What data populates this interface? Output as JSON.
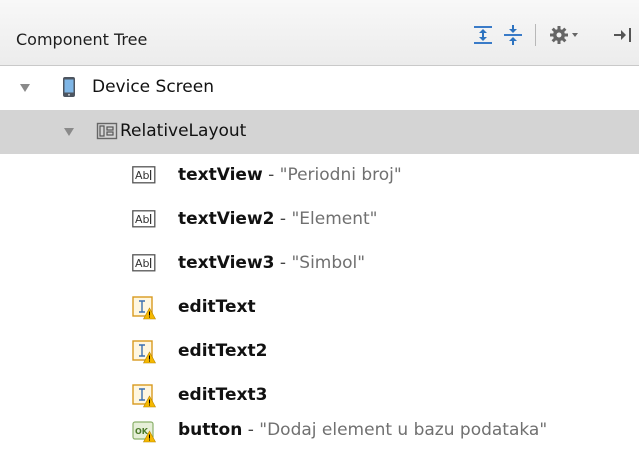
{
  "panel": {
    "title": "Component Tree"
  },
  "toolbar": {
    "icons": [
      "expand-all-icon",
      "collapse-all-icon",
      "gear-icon",
      "hide-panel-icon"
    ]
  },
  "tree": {
    "root": {
      "label": "Device Screen",
      "icon": "phone-icon"
    },
    "layout": {
      "label": "RelativeLayout",
      "icon": "relative-layout-icon"
    },
    "items": [
      {
        "name": "textView",
        "sep": " - ",
        "text": "\"Periodni broj\"",
        "icon": "textview-icon"
      },
      {
        "name": "textView2",
        "sep": " - ",
        "text": "\"Element\"",
        "icon": "textview-icon"
      },
      {
        "name": "textView3",
        "sep": " - ",
        "text": "\"Simbol\"",
        "icon": "textview-icon"
      },
      {
        "name": "editText",
        "sep": "",
        "text": "",
        "icon": "edittext-warning-icon"
      },
      {
        "name": "editText2",
        "sep": "",
        "text": "",
        "icon": "edittext-warning-icon"
      },
      {
        "name": "editText3",
        "sep": "",
        "text": "",
        "icon": "edittext-warning-icon"
      },
      {
        "name": "button",
        "sep": " - ",
        "text": "\"Dodaj element u bazu podataka\"",
        "icon": "button-ok-icon"
      }
    ],
    "button_icon_text": "OK"
  },
  "colors": {
    "selected_row": "#d4d4d4",
    "warning": "#f5b800",
    "accent_blue": "#2d73c0",
    "string_gray": "#707070"
  }
}
